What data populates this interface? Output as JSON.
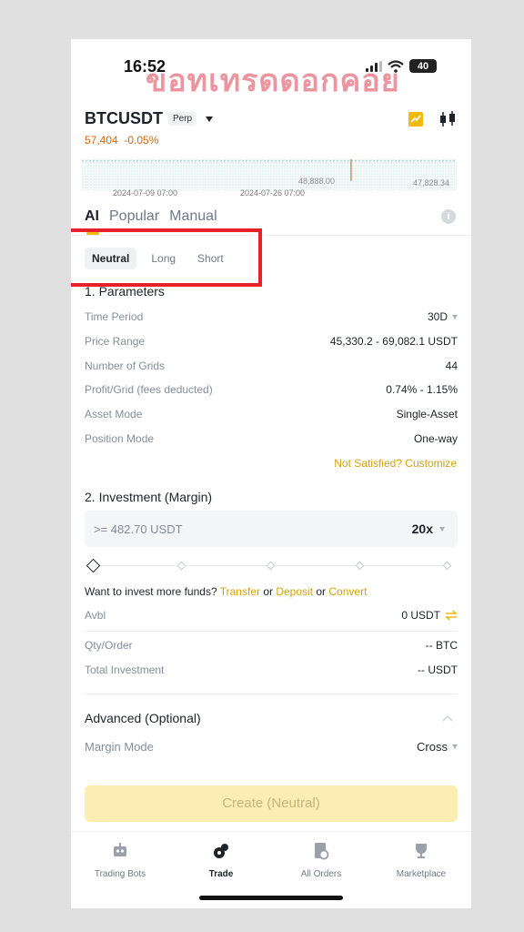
{
  "status": {
    "time": "16:52",
    "battery": "40"
  },
  "watermark": "ขอทเทรดดอกคอย",
  "header": {
    "pair": "BTCUSDT",
    "badge": "Perp",
    "price": "57,404",
    "change": "-0.05%"
  },
  "mini_chart": {
    "mid_label": "48,888.00",
    "right_label": "47,828.34",
    "date_start": "2024-07-09 07:00",
    "date_mid": "2024-07-26 07:00"
  },
  "tabs": [
    "AI",
    "Popular",
    "Manual"
  ],
  "direction": [
    "Neutral",
    "Long",
    "Short"
  ],
  "parameters": {
    "title": "1. Parameters",
    "rows": [
      {
        "label": "Time Period",
        "value": "30D"
      },
      {
        "label": "Price Range",
        "value": "45,330.2 - 69,082.1 USDT"
      },
      {
        "label": "Number of Grids",
        "value": "44"
      },
      {
        "label": "Profit/Grid (fees deducted)",
        "value": "0.74% - 1.15%"
      },
      {
        "label": "Asset Mode",
        "value": "Single-Asset"
      },
      {
        "label": "Position Mode",
        "value": "One-way"
      }
    ],
    "customize": "Not Satisfied? Customize"
  },
  "investment": {
    "title": "2. Investment (Margin)",
    "placeholder": ">= 482.70 USDT",
    "leverage": "20x",
    "slider_level": 0,
    "more_text": "Want to invest more funds?",
    "transfer": "Transfer",
    "or1": "or",
    "deposit": "Deposit",
    "or2": "or",
    "convert": "Convert",
    "avbl_label": "Avbl",
    "avbl_value": "0 USDT",
    "qty_label": "Qty/Order",
    "qty_value": "-- BTC",
    "total_label": "Total Investment",
    "total_value": "-- USDT"
  },
  "advanced": {
    "title": "Advanced (Optional)",
    "margin_label": "Margin Mode",
    "margin_value": "Cross"
  },
  "create_button": "Create (Neutral)",
  "nav": [
    {
      "label": "Trading Bots",
      "icon": "robot-icon"
    },
    {
      "label": "Trade",
      "icon": "trade-icon"
    },
    {
      "label": "All Orders",
      "icon": "orders-icon"
    },
    {
      "label": "Marketplace",
      "icon": "trophy-icon"
    }
  ],
  "colors": {
    "accent": "#f0b90b",
    "price": "#d9650d",
    "highlight_box": "#e8202a"
  }
}
